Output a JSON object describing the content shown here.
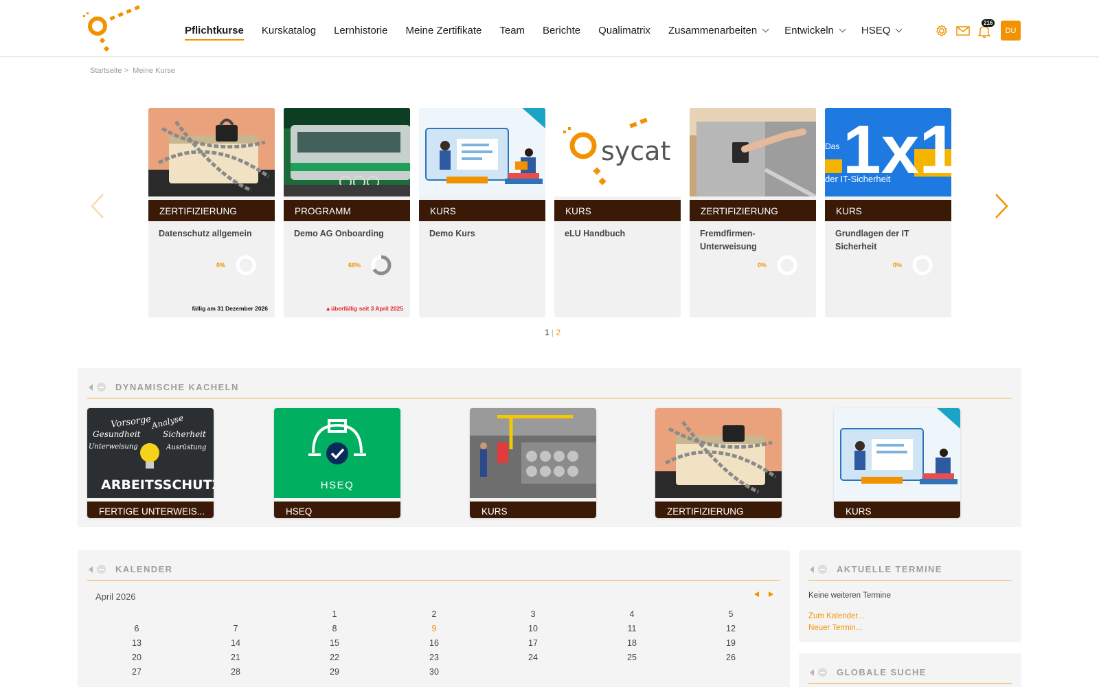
{
  "nav": {
    "items": [
      {
        "label": "Pflichtkurse",
        "active": true,
        "dropdown": false
      },
      {
        "label": "Kurskatalog",
        "active": false,
        "dropdown": false
      },
      {
        "label": "Lernhistorie",
        "active": false,
        "dropdown": false
      },
      {
        "label": "Meine Zertifikate",
        "active": false,
        "dropdown": false
      },
      {
        "label": "Team",
        "active": false,
        "dropdown": false
      },
      {
        "label": "Berichte",
        "active": false,
        "dropdown": false
      },
      {
        "label": "Qualimatrix",
        "active": false,
        "dropdown": false
      },
      {
        "label": "Zusammenarbeiten",
        "active": false,
        "dropdown": true
      },
      {
        "label": "Entwickeln",
        "active": false,
        "dropdown": true
      },
      {
        "label": "HSEQ",
        "active": false,
        "dropdown": true
      }
    ],
    "notification_count": "216",
    "avatar_initials": "DU",
    "accent_color": "#f39200"
  },
  "breadcrumb": {
    "home": "Startseite",
    "separator": ">",
    "current": "Meine Kurse"
  },
  "courses": [
    {
      "type": "ZERTIFIZIERUNG",
      "title": "Datenschutz allgemein",
      "progress_label": "0%",
      "progress": 0,
      "due": "fällig am 31 Dezember 2026",
      "overdue": false,
      "image": "lock-chain-book"
    },
    {
      "type": "PROGRAMM",
      "title": "Demo AG Onboarding",
      "progress_label": "66%",
      "progress": 0.66,
      "due": "überfällig seit 3 April 2025",
      "overdue": true,
      "image": "tram"
    },
    {
      "type": "KURS",
      "title": "Demo Kurs",
      "progress_label": "",
      "progress": null,
      "due": "",
      "overdue": false,
      "image": "elearning-illustration"
    },
    {
      "type": "KURS",
      "title": "eLU Handbuch",
      "progress_label": "",
      "progress": null,
      "due": "",
      "overdue": false,
      "image": "sycat-logo"
    },
    {
      "type": "ZERTIFIZIERUNG",
      "title": "Fremdfirmen-Unterweisung",
      "progress_label": "0%",
      "progress": 0,
      "due": "",
      "overdue": false,
      "image": "turnstile"
    },
    {
      "type": "KURS",
      "title": "Grundlagen der IT Sicherheit",
      "progress_label": "0%",
      "progress": 0,
      "due": "",
      "overdue": false,
      "image": "it-security-1x1"
    }
  ],
  "carousel_logo_text": "sycat",
  "it_image_text": {
    "big": "1x1",
    "small_left": "Das",
    "small_bottom": "der IT-Sicherheit"
  },
  "pager": {
    "current": "1",
    "separator": "|",
    "next": "2"
  },
  "dynamic": {
    "title": "DYNAMISCHE KACHELN",
    "tiles": [
      {
        "label": "FERTIGE UNTERWEIS...",
        "image": "arbeitsschutz-chalkboard"
      },
      {
        "label": "HSEQ",
        "image": "hseq-helmet"
      },
      {
        "label": "KURS",
        "image": "warehouse"
      },
      {
        "label": "ZERTIFIZIERUNG",
        "image": "lock-chain-book"
      },
      {
        "label": "KURS",
        "image": "elearning-illustration"
      }
    ],
    "chalk_words": [
      "Vorsorge",
      "Analyse",
      "Gesundheit",
      "Sicherheit",
      "Unterweisung",
      "Ausrüstung",
      "ARBEITSSCHUTZ"
    ],
    "hseq_text": "HSEQ"
  },
  "calendar": {
    "title": "KALENDER",
    "month": "April 2026",
    "today": 9,
    "weeks": [
      [
        "",
        "",
        "1",
        "2",
        "3",
        "4",
        "5"
      ],
      [
        "6",
        "7",
        "8",
        "9",
        "10",
        "11",
        "12"
      ],
      [
        "13",
        "14",
        "15",
        "16",
        "17",
        "18",
        "19"
      ],
      [
        "20",
        "21",
        "22",
        "23",
        "24",
        "25",
        "26"
      ],
      [
        "27",
        "28",
        "29",
        "30",
        "",
        "",
        ""
      ]
    ]
  },
  "termine": {
    "title": "AKTUELLE TERMINE",
    "empty": "Keine weiteren Termine",
    "link_calendar": "Zum Kalender...",
    "link_new": "Neuer Termin..."
  },
  "suche": {
    "title": "GLOBALE SUCHE"
  }
}
